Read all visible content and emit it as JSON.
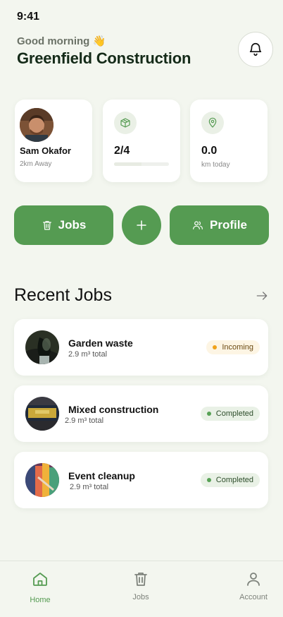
{
  "status": {
    "time": "9:41"
  },
  "header": {
    "greeting": "Good morning",
    "greeting_emoji": "👋",
    "company": "Greenfield Construction",
    "bell_icon": "bell-icon"
  },
  "stats": {
    "person": {
      "name": "Sam Okafor",
      "sub": "2km Away"
    },
    "boxes": {
      "value": "2/4",
      "progress": 0.5,
      "icon": "box-icon"
    },
    "distance": {
      "value": "0.0",
      "sub": "km today",
      "icon": "map-pin-icon"
    }
  },
  "actions": {
    "jobs_label": "Jobs",
    "profile_label": "Profile"
  },
  "recent": {
    "title": "Recent Jobs",
    "jobs": [
      {
        "title": "Garden waste",
        "sub": "2.9 m³ total",
        "status": "Incoming"
      },
      {
        "title": "Mixed construction",
        "sub": "2.9 m³ total",
        "status": "Completed"
      },
      {
        "title": "Event cleanup",
        "sub": "2.9 m³ total",
        "status": "Completed"
      }
    ]
  },
  "tabs": {
    "home": "Home",
    "jobs": "Jobs",
    "account": "Account"
  },
  "colors": {
    "primary": "#559b52",
    "background": "#f3f6ef",
    "incoming": "#f0a21b",
    "completed": "#57a155"
  }
}
